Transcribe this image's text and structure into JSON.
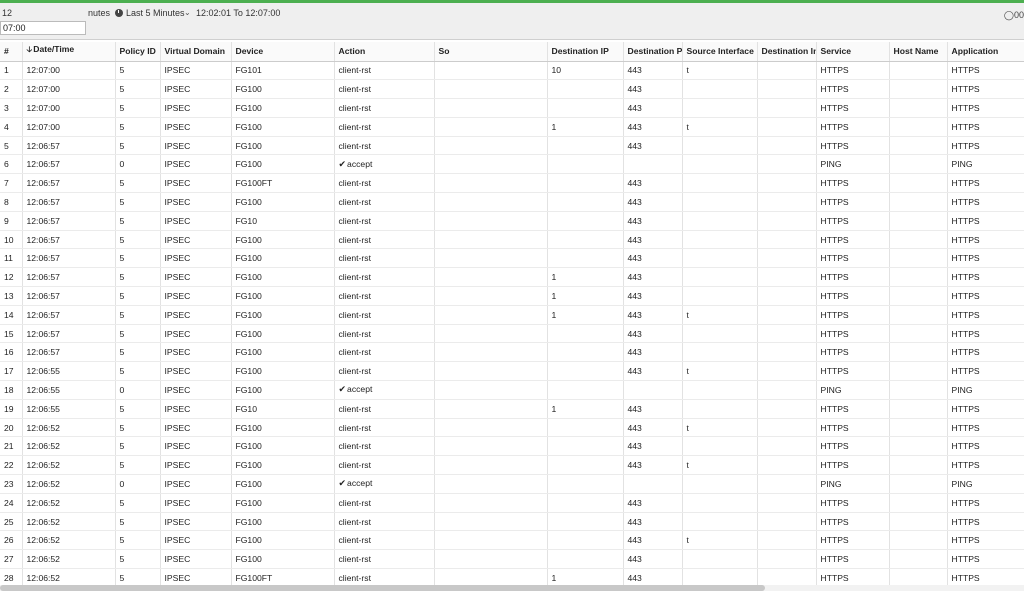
{
  "toolbar": {
    "count_prefix": "12",
    "range_unit": "nutes",
    "range_label": "Last 5 Minutes",
    "time_range": "12:02:01 To 12:07:00",
    "search_value": "07:00",
    "user_label": "00"
  },
  "columns": [
    "#",
    "Date/Time",
    "Policy ID",
    "Virtual Domain",
    "Device",
    "Action",
    "So",
    "Destination IP",
    "Destination Po",
    "Source Interface",
    "Destination In",
    "Service",
    "Host Name",
    "Application"
  ],
  "rows": [
    {
      "n": "1",
      "time": "12:07:00",
      "policy": "5",
      "vdom": "IPSEC",
      "device": "FG101",
      "action": "client-rst",
      "accept": false,
      "dst_ip": "10",
      "dst_port": "443",
      "src_if": "t",
      "service": "HTTPS",
      "app": "HTTPS"
    },
    {
      "n": "2",
      "time": "12:07:00",
      "policy": "5",
      "vdom": "IPSEC",
      "device": "FG100",
      "action": "client-rst",
      "accept": false,
      "dst_ip": "",
      "dst_port": "443",
      "src_if": "",
      "service": "HTTPS",
      "app": "HTTPS"
    },
    {
      "n": "3",
      "time": "12:07:00",
      "policy": "5",
      "vdom": "IPSEC",
      "device": "FG100",
      "action": "client-rst",
      "accept": false,
      "dst_ip": "",
      "dst_port": "443",
      "src_if": "",
      "service": "HTTPS",
      "app": "HTTPS"
    },
    {
      "n": "4",
      "time": "12:07:00",
      "policy": "5",
      "vdom": "IPSEC",
      "device": "FG100",
      "action": "client-rst",
      "accept": false,
      "dst_ip": "1",
      "dst_port": "443",
      "src_if": "t",
      "service": "HTTPS",
      "app": "HTTPS"
    },
    {
      "n": "5",
      "time": "12:06:57",
      "policy": "5",
      "vdom": "IPSEC",
      "device": "FG100",
      "action": "client-rst",
      "accept": false,
      "dst_ip": "",
      "dst_port": "443",
      "src_if": "",
      "service": "HTTPS",
      "app": "HTTPS"
    },
    {
      "n": "6",
      "time": "12:06:57",
      "policy": "0",
      "vdom": "IPSEC",
      "device": "FG100",
      "action": "accept",
      "accept": true,
      "dst_ip": "",
      "dst_port": "",
      "src_if": "",
      "service": "PING",
      "app": "PING"
    },
    {
      "n": "7",
      "time": "12:06:57",
      "policy": "5",
      "vdom": "IPSEC",
      "device": "FG100FT",
      "action": "client-rst",
      "accept": false,
      "dst_ip": "",
      "dst_port": "443",
      "src_if": "",
      "service": "HTTPS",
      "app": "HTTPS"
    },
    {
      "n": "8",
      "time": "12:06:57",
      "policy": "5",
      "vdom": "IPSEC",
      "device": "FG100",
      "action": "client-rst",
      "accept": false,
      "dst_ip": "",
      "dst_port": "443",
      "src_if": "",
      "service": "HTTPS",
      "app": "HTTPS"
    },
    {
      "n": "9",
      "time": "12:06:57",
      "policy": "5",
      "vdom": "IPSEC",
      "device": "FG10",
      "action": "client-rst",
      "accept": false,
      "dst_ip": "",
      "dst_port": "443",
      "src_if": "",
      "service": "HTTPS",
      "app": "HTTPS"
    },
    {
      "n": "10",
      "time": "12:06:57",
      "policy": "5",
      "vdom": "IPSEC",
      "device": "FG100",
      "action": "client-rst",
      "accept": false,
      "dst_ip": "",
      "dst_port": "443",
      "src_if": "",
      "service": "HTTPS",
      "app": "HTTPS"
    },
    {
      "n": "11",
      "time": "12:06:57",
      "policy": "5",
      "vdom": "IPSEC",
      "device": "FG100",
      "action": "client-rst",
      "accept": false,
      "dst_ip": "",
      "dst_port": "443",
      "src_if": "",
      "service": "HTTPS",
      "app": "HTTPS"
    },
    {
      "n": "12",
      "time": "12:06:57",
      "policy": "5",
      "vdom": "IPSEC",
      "device": "FG100",
      "action": "client-rst",
      "accept": false,
      "dst_ip": "1",
      "dst_port": "443",
      "src_if": "",
      "service": "HTTPS",
      "app": "HTTPS"
    },
    {
      "n": "13",
      "time": "12:06:57",
      "policy": "5",
      "vdom": "IPSEC",
      "device": "FG100",
      "action": "client-rst",
      "accept": false,
      "dst_ip": "1",
      "dst_port": "443",
      "src_if": "",
      "service": "HTTPS",
      "app": "HTTPS"
    },
    {
      "n": "14",
      "time": "12:06:57",
      "policy": "5",
      "vdom": "IPSEC",
      "device": "FG100",
      "action": "client-rst",
      "accept": false,
      "dst_ip": "1",
      "dst_port": "443",
      "src_if": "t",
      "service": "HTTPS",
      "app": "HTTPS"
    },
    {
      "n": "15",
      "time": "12:06:57",
      "policy": "5",
      "vdom": "IPSEC",
      "device": "FG100",
      "action": "client-rst",
      "accept": false,
      "dst_ip": "",
      "dst_port": "443",
      "src_if": "",
      "service": "HTTPS",
      "app": "HTTPS"
    },
    {
      "n": "16",
      "time": "12:06:57",
      "policy": "5",
      "vdom": "IPSEC",
      "device": "FG100",
      "action": "client-rst",
      "accept": false,
      "dst_ip": "",
      "dst_port": "443",
      "src_if": "",
      "service": "HTTPS",
      "app": "HTTPS"
    },
    {
      "n": "17",
      "time": "12:06:55",
      "policy": "5",
      "vdom": "IPSEC",
      "device": "FG100",
      "action": "client-rst",
      "accept": false,
      "dst_ip": "",
      "dst_port": "443",
      "src_if": "t",
      "service": "HTTPS",
      "app": "HTTPS"
    },
    {
      "n": "18",
      "time": "12:06:55",
      "policy": "0",
      "vdom": "IPSEC",
      "device": "FG100",
      "action": "accept",
      "accept": true,
      "dst_ip": "",
      "dst_port": "",
      "src_if": "",
      "service": "PING",
      "app": "PING"
    },
    {
      "n": "19",
      "time": "12:06:55",
      "policy": "5",
      "vdom": "IPSEC",
      "device": "FG10",
      "action": "client-rst",
      "accept": false,
      "dst_ip": "1",
      "dst_port": "443",
      "src_if": "",
      "service": "HTTPS",
      "app": "HTTPS"
    },
    {
      "n": "20",
      "time": "12:06:52",
      "policy": "5",
      "vdom": "IPSEC",
      "device": "FG100",
      "action": "client-rst",
      "accept": false,
      "dst_ip": "",
      "dst_port": "443",
      "src_if": "t",
      "service": "HTTPS",
      "app": "HTTPS"
    },
    {
      "n": "21",
      "time": "12:06:52",
      "policy": "5",
      "vdom": "IPSEC",
      "device": "FG100",
      "action": "client-rst",
      "accept": false,
      "dst_ip": "",
      "dst_port": "443",
      "src_if": "",
      "service": "HTTPS",
      "app": "HTTPS"
    },
    {
      "n": "22",
      "time": "12:06:52",
      "policy": "5",
      "vdom": "IPSEC",
      "device": "FG100",
      "action": "client-rst",
      "accept": false,
      "dst_ip": "",
      "dst_port": "443",
      "src_if": "t",
      "service": "HTTPS",
      "app": "HTTPS"
    },
    {
      "n": "23",
      "time": "12:06:52",
      "policy": "0",
      "vdom": "IPSEC",
      "device": "FG100",
      "action": "accept",
      "accept": true,
      "dst_ip": "",
      "dst_port": "",
      "src_if": "",
      "service": "PING",
      "app": "PING"
    },
    {
      "n": "24",
      "time": "12:06:52",
      "policy": "5",
      "vdom": "IPSEC",
      "device": "FG100",
      "action": "client-rst",
      "accept": false,
      "dst_ip": "",
      "dst_port": "443",
      "src_if": "",
      "service": "HTTPS",
      "app": "HTTPS"
    },
    {
      "n": "25",
      "time": "12:06:52",
      "policy": "5",
      "vdom": "IPSEC",
      "device": "FG100",
      "action": "client-rst",
      "accept": false,
      "dst_ip": "",
      "dst_port": "443",
      "src_if": "",
      "service": "HTTPS",
      "app": "HTTPS"
    },
    {
      "n": "26",
      "time": "12:06:52",
      "policy": "5",
      "vdom": "IPSEC",
      "device": "FG100",
      "action": "client-rst",
      "accept": false,
      "dst_ip": "",
      "dst_port": "443",
      "src_if": "t",
      "service": "HTTPS",
      "app": "HTTPS"
    },
    {
      "n": "27",
      "time": "12:06:52",
      "policy": "5",
      "vdom": "IPSEC",
      "device": "FG100",
      "action": "client-rst",
      "accept": false,
      "dst_ip": "",
      "dst_port": "443",
      "src_if": "",
      "service": "HTTPS",
      "app": "HTTPS"
    },
    {
      "n": "28",
      "time": "12:06:52",
      "policy": "5",
      "vdom": "IPSEC",
      "device": "FG100FT",
      "action": "client-rst",
      "accept": false,
      "dst_ip": "1",
      "dst_port": "443",
      "src_if": "",
      "service": "HTTPS",
      "app": "HTTPS"
    }
  ]
}
